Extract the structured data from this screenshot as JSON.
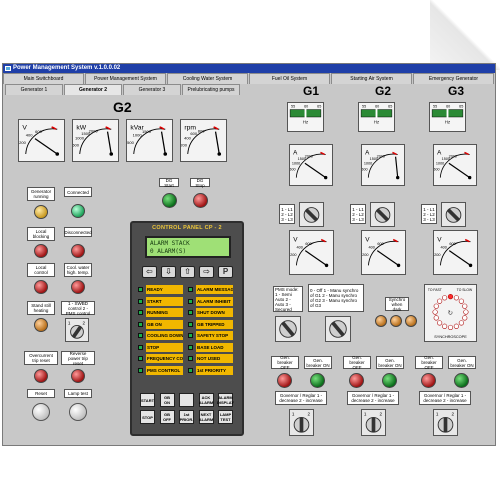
{
  "app": {
    "title": "Power Management System  v.1.0.0.02"
  },
  "tabs_main": [
    {
      "label": "Main Switchboard",
      "active": false
    },
    {
      "label": "Power Management System",
      "active": false
    },
    {
      "label": "Cooling Water System",
      "active": false
    },
    {
      "label": "Fuel Oil System",
      "active": false
    },
    {
      "label": "Starting Air System",
      "active": false
    },
    {
      "label": "Emergency Generator",
      "active": false
    }
  ],
  "tabs_gen": [
    {
      "label": "Generator 1",
      "active": false
    },
    {
      "label": "Generator 2",
      "active": true
    },
    {
      "label": "Generator 3",
      "active": false
    },
    {
      "label": "Prelubricating pumps",
      "active": false
    }
  ],
  "g2": {
    "heading": "G2",
    "gauges": [
      {
        "unit": "V",
        "ticks": [
          "200",
          "400",
          "600"
        ],
        "needle": 0.55
      },
      {
        "unit": "kW",
        "ticks": [
          "500",
          "1000",
          "1500",
          "2000"
        ],
        "needle": 0.08
      },
      {
        "unit": "kVar",
        "ticks": [
          "500",
          "1000",
          "1500"
        ],
        "needle": 0.08
      },
      {
        "unit": "rpm",
        "ticks": [
          "200",
          "400",
          "600",
          "800"
        ],
        "needle": 0.08
      }
    ],
    "left_indicators": {
      "gen_running": "Generator running",
      "connected": "Connected",
      "local_blocking": "Local blocking",
      "disconnected": "Disconnected",
      "local_control": "Local control",
      "cool_water": "Cool. water high. temp.",
      "stand_still": "Stand still heating",
      "swbd_control": "1 - SWBD control 2 - PMS control",
      "overcurrent": "Overcurrent trip reset",
      "reverse_power": "Reverse power trip reset",
      "reset": "Reset",
      "lamp_test": "Lamp test"
    },
    "dg_start": "DG Start",
    "dg_stop": "DG Stop",
    "switch_labels": [
      "1",
      "2"
    ]
  },
  "control_panel": {
    "title": "CONTROL PANEL  CP - 2",
    "display_line1": "ALARM STACK",
    "display_line2": "0  ALARM(S)",
    "keys": [
      "⇦",
      "⇩",
      "⇧",
      "⇨",
      "P"
    ],
    "status_left": [
      "READY",
      "START",
      "RUNNING",
      "GB ON",
      "COOLING DOWN",
      "STOP",
      "FREQUENCY CONTROL",
      "PMS CONTROL"
    ],
    "status_right": [
      "ALARM MESSAGE SEE DISPLAY",
      "ALARM INHIBIT",
      "SHUT DOWN",
      "GB TRIPPED",
      "SAFETY STOP",
      "BASE LOAD",
      "NOT USED",
      "1st PRIORITY"
    ],
    "buttons_row1": [
      "START",
      "GB ON",
      "",
      "ACK ALARM",
      "ALARM DISPLAY"
    ],
    "buttons_row2": [
      "STOP",
      "GB OFF",
      "1st PRIOR.",
      "NEXT ALARM",
      "LAMP TEST"
    ]
  },
  "right": {
    "headings": [
      "G1",
      "G2",
      "G3"
    ],
    "hz": {
      "label": "Hz",
      "scale": [
        "55",
        "60",
        "65"
      ],
      "values": [
        60,
        60,
        60
      ]
    },
    "ammeters": [
      {
        "unit": "A",
        "ticks": [
          "500",
          "1000",
          "1500",
          "2000"
        ],
        "needle": 0.55
      },
      {
        "unit": "A",
        "ticks": [
          "500",
          "1000",
          "1500",
          "2000"
        ],
        "needle": 0.05
      },
      {
        "unit": "A",
        "ticks": [
          "500",
          "1000",
          "1500",
          "2000"
        ],
        "needle": 0.55
      }
    ],
    "phase_labels": [
      "1 - L1",
      "2 - L2",
      "3 - L3"
    ],
    "voltmeters": [
      {
        "unit": "V",
        "ticks": [
          "200",
          "400",
          "600"
        ],
        "needle": 0.55
      },
      {
        "unit": "V",
        "ticks": [
          "200",
          "400",
          "600"
        ],
        "needle": 0.55
      },
      {
        "unit": "V",
        "ticks": [
          "200",
          "400",
          "600"
        ],
        "needle": 0.55
      }
    ],
    "pms_mode": "PMS mode: 1 - Semi Auto 2 - Auto 3 - Secured",
    "menu_synchro": "0 - Off  1 - Manu synchro of G1  2 - Manu synchro of G2  3 - Manu synchro of G3",
    "synchro_when_dark": "Synchro when dark",
    "synchroscope": {
      "label": "SYNCHROSCOPE",
      "fast": "TO FAST",
      "slow": "TO SLOW"
    },
    "breaker_off": "Gen. breaker OFF",
    "breaker_on": "Gen. breaker ON",
    "governor": "Governor / Reglar  1 - decrease  2 - increase",
    "switch_labels": [
      "1",
      "2"
    ]
  }
}
